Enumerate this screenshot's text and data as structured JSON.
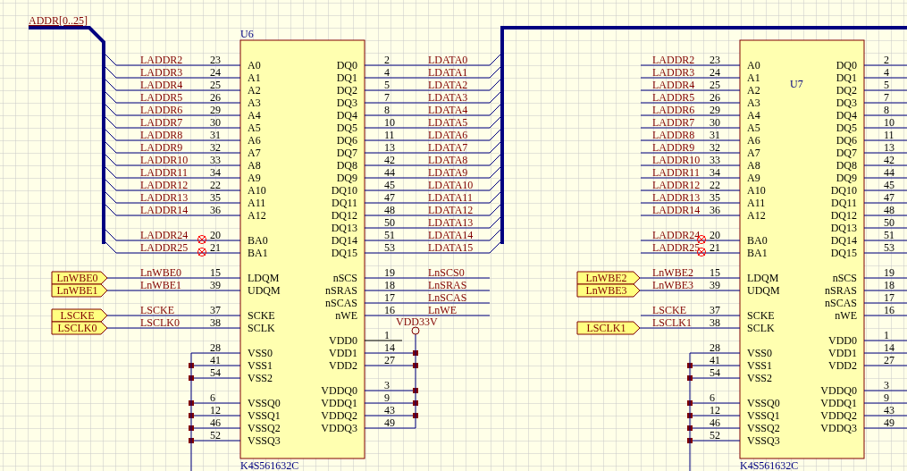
{
  "bus_label": "ADDR[0..25]",
  "parts": [
    {
      "designator": "U6",
      "designator_inside": false,
      "part_number": "K4S561632C",
      "power_net": "VDD33V",
      "left_groups": [
        [
          {
            "number": "23",
            "name": "A0",
            "net": "LADDR2",
            "kind": "bus",
            "no_erc": false
          },
          {
            "number": "24",
            "name": "A1",
            "net": "LADDR3",
            "kind": "bus",
            "no_erc": false
          },
          {
            "number": "25",
            "name": "A2",
            "net": "LADDR4",
            "kind": "bus",
            "no_erc": false
          },
          {
            "number": "26",
            "name": "A3",
            "net": "LADDR5",
            "kind": "bus",
            "no_erc": false
          },
          {
            "number": "29",
            "name": "A4",
            "net": "LADDR6",
            "kind": "bus",
            "no_erc": false
          },
          {
            "number": "30",
            "name": "A5",
            "net": "LADDR7",
            "kind": "bus",
            "no_erc": false
          },
          {
            "number": "31",
            "name": "A6",
            "net": "LADDR8",
            "kind": "bus",
            "no_erc": false
          },
          {
            "number": "32",
            "name": "A7",
            "net": "LADDR9",
            "kind": "bus",
            "no_erc": false
          },
          {
            "number": "33",
            "name": "A8",
            "net": "LADDR10",
            "kind": "bus",
            "no_erc": false
          },
          {
            "number": "34",
            "name": "A9",
            "net": "LADDR11",
            "kind": "bus",
            "no_erc": false
          },
          {
            "number": "22",
            "name": "A10",
            "net": "LADDR12",
            "kind": "bus",
            "no_erc": false
          },
          {
            "number": "35",
            "name": "A11",
            "net": "LADDR13",
            "kind": "bus",
            "no_erc": false
          },
          {
            "number": "36",
            "name": "A12",
            "net": "LADDR14",
            "kind": "bus",
            "no_erc": false
          }
        ],
        [
          {
            "number": "20",
            "name": "BA0",
            "net": "LADDR24",
            "kind": "bus",
            "no_erc": true
          },
          {
            "number": "21",
            "name": "BA1",
            "net": "LADDR25",
            "kind": "bus",
            "no_erc": true
          }
        ],
        [
          {
            "number": "15",
            "name": "LDQM",
            "net": "LnWBE0",
            "port": "LnWBE0",
            "kind": "wire",
            "no_erc": false
          },
          {
            "number": "39",
            "name": "UDQM",
            "net": "LnWBE1",
            "port": "LnWBE1",
            "kind": "wire",
            "no_erc": false
          }
        ],
        [
          {
            "number": "37",
            "name": "SCKE",
            "net": "LSCKE",
            "port": "LSCKE",
            "kind": "wire",
            "no_erc": false
          },
          {
            "number": "38",
            "name": "SCLK",
            "net": "LSCLK0",
            "port": "LSCLK0",
            "kind": "wire",
            "no_erc": false
          }
        ],
        [
          {
            "number": "28",
            "name": "VSS0",
            "kind": "rail",
            "junction": false,
            "no_erc": false
          },
          {
            "number": "41",
            "name": "VSS1",
            "kind": "rail",
            "junction": true,
            "no_erc": false
          },
          {
            "number": "54",
            "name": "VSS2",
            "kind": "rail",
            "junction": true,
            "no_erc": false
          }
        ],
        [
          {
            "number": "6",
            "name": "VSSQ0",
            "kind": "rail",
            "junction": true,
            "no_erc": false
          },
          {
            "number": "12",
            "name": "VSSQ1",
            "kind": "rail",
            "junction": true,
            "no_erc": false
          },
          {
            "number": "46",
            "name": "VSSQ2",
            "kind": "rail",
            "junction": true,
            "no_erc": false
          },
          {
            "number": "52",
            "name": "VSSQ3",
            "kind": "rail",
            "junction": true,
            "no_erc": false
          }
        ]
      ],
      "right_groups": [
        [
          {
            "number": "2",
            "name": "DQ0",
            "net": "LDATA0",
            "kind": "bus"
          },
          {
            "number": "4",
            "name": "DQ1",
            "net": "LDATA1",
            "kind": "bus"
          },
          {
            "number": "5",
            "name": "DQ2",
            "net": "LDATA2",
            "kind": "bus"
          },
          {
            "number": "7",
            "name": "DQ3",
            "net": "LDATA3",
            "kind": "bus"
          },
          {
            "number": "8",
            "name": "DQ4",
            "net": "LDATA4",
            "kind": "bus"
          },
          {
            "number": "10",
            "name": "DQ5",
            "net": "LDATA5",
            "kind": "bus"
          },
          {
            "number": "11",
            "name": "DQ6",
            "net": "LDATA6",
            "kind": "bus"
          },
          {
            "number": "13",
            "name": "DQ7",
            "net": "LDATA7",
            "kind": "bus"
          },
          {
            "number": "42",
            "name": "DQ8",
            "net": "LDATA8",
            "kind": "bus"
          },
          {
            "number": "44",
            "name": "DQ9",
            "net": "LDATA9",
            "kind": "bus"
          },
          {
            "number": "45",
            "name": "DQ10",
            "net": "LDATA10",
            "kind": "bus"
          },
          {
            "number": "47",
            "name": "DQ11",
            "net": "LDATA11",
            "kind": "bus"
          },
          {
            "number": "48",
            "name": "DQ12",
            "net": "LDATA12",
            "kind": "bus"
          },
          {
            "number": "50",
            "name": "DQ13",
            "net": "LDATA13",
            "kind": "bus"
          },
          {
            "number": "51",
            "name": "DQ14",
            "net": "LDATA14",
            "kind": "bus"
          },
          {
            "number": "53",
            "name": "DQ15",
            "net": "LDATA15",
            "kind": "bus"
          }
        ],
        [
          {
            "number": "19",
            "name": "nSCS",
            "net": "LnSCS0",
            "kind": "wire"
          },
          {
            "number": "18",
            "name": "nSRAS",
            "net": "LnSRAS",
            "kind": "wire"
          },
          {
            "number": "17",
            "name": "nSCAS",
            "net": "LnSCAS",
            "kind": "wire"
          },
          {
            "number": "16",
            "name": "nWE",
            "net": "LnWE",
            "kind": "wire"
          }
        ],
        [
          {
            "number": "1",
            "name": "VDD0",
            "kind": "stub"
          },
          {
            "number": "14",
            "name": "VDD1",
            "kind": "rail",
            "junction": true
          },
          {
            "number": "27",
            "name": "VDD2",
            "kind": "rail",
            "junction": true
          }
        ],
        [
          {
            "number": "3",
            "name": "VDDQ0",
            "kind": "rail",
            "junction": true
          },
          {
            "number": "9",
            "name": "VDDQ1",
            "kind": "rail",
            "junction": true
          },
          {
            "number": "43",
            "name": "VDDQ2",
            "kind": "rail",
            "junction": true
          },
          {
            "number": "49",
            "name": "VDDQ3",
            "kind": "rail",
            "junction": false
          }
        ]
      ]
    },
    {
      "designator": "U7",
      "designator_inside": true,
      "part_number": "K4S561632C",
      "left_groups": [
        [
          {
            "number": "23",
            "name": "A0",
            "net": "LADDR2",
            "kind": "wire",
            "no_erc": false
          },
          {
            "number": "24",
            "name": "A1",
            "net": "LADDR3",
            "kind": "wire",
            "no_erc": false
          },
          {
            "number": "25",
            "name": "A2",
            "net": "LADDR4",
            "kind": "wire",
            "no_erc": false
          },
          {
            "number": "26",
            "name": "A3",
            "net": "LADDR5",
            "kind": "wire",
            "no_erc": false
          },
          {
            "number": "29",
            "name": "A4",
            "net": "LADDR6",
            "kind": "wire",
            "no_erc": false
          },
          {
            "number": "30",
            "name": "A5",
            "net": "LADDR7",
            "kind": "wire",
            "no_erc": false
          },
          {
            "number": "31",
            "name": "A6",
            "net": "LADDR8",
            "kind": "wire",
            "no_erc": false
          },
          {
            "number": "32",
            "name": "A7",
            "net": "LADDR9",
            "kind": "wire",
            "no_erc": false
          },
          {
            "number": "33",
            "name": "A8",
            "net": "LADDR10",
            "kind": "wire",
            "no_erc": false
          },
          {
            "number": "34",
            "name": "A9",
            "net": "LADDR11",
            "kind": "wire",
            "no_erc": false
          },
          {
            "number": "22",
            "name": "A10",
            "net": "LADDR12",
            "kind": "wire",
            "no_erc": false
          },
          {
            "number": "35",
            "name": "A11",
            "net": "LADDR13",
            "kind": "wire",
            "no_erc": false
          },
          {
            "number": "36",
            "name": "A12",
            "net": "LADDR14",
            "kind": "wire",
            "no_erc": false
          }
        ],
        [
          {
            "number": "20",
            "name": "BA0",
            "net": "LADDR24",
            "kind": "wire",
            "no_erc": true
          },
          {
            "number": "21",
            "name": "BA1",
            "net": "LADDR25",
            "kind": "wire",
            "no_erc": true
          }
        ],
        [
          {
            "number": "15",
            "name": "LDQM",
            "net": "LnWBE2",
            "port": "LnWBE2",
            "kind": "wire",
            "no_erc": false
          },
          {
            "number": "39",
            "name": "UDQM",
            "net": "LnWBE3",
            "port": "LnWBE3",
            "kind": "wire",
            "no_erc": false
          }
        ],
        [
          {
            "number": "37",
            "name": "SCKE",
            "net": "LSCKE",
            "kind": "wire",
            "no_erc": false
          },
          {
            "number": "38",
            "name": "SCLK",
            "net": "LSCLK1",
            "port": "LSCLK1",
            "kind": "wire",
            "no_erc": false
          }
        ],
        [
          {
            "number": "28",
            "name": "VSS0",
            "kind": "rail",
            "junction": false,
            "no_erc": false
          },
          {
            "number": "41",
            "name": "VSS1",
            "kind": "rail",
            "junction": true,
            "no_erc": false
          },
          {
            "number": "54",
            "name": "VSS2",
            "kind": "rail",
            "junction": true,
            "no_erc": false
          }
        ],
        [
          {
            "number": "6",
            "name": "VSSQ0",
            "kind": "rail",
            "junction": true,
            "no_erc": false
          },
          {
            "number": "12",
            "name": "VSSQ1",
            "kind": "rail",
            "junction": true,
            "no_erc": false
          },
          {
            "number": "46",
            "name": "VSSQ2",
            "kind": "rail",
            "junction": true,
            "no_erc": false
          },
          {
            "number": "52",
            "name": "VSSQ3",
            "kind": "rail",
            "junction": true,
            "no_erc": false
          }
        ]
      ],
      "right_groups": [
        [
          {
            "number": "2",
            "name": "DQ0",
            "kind": "edge"
          },
          {
            "number": "4",
            "name": "DQ1",
            "kind": "edge"
          },
          {
            "number": "5",
            "name": "DQ2",
            "kind": "edge"
          },
          {
            "number": "7",
            "name": "DQ3",
            "kind": "edge"
          },
          {
            "number": "8",
            "name": "DQ4",
            "kind": "edge"
          },
          {
            "number": "10",
            "name": "DQ5",
            "kind": "edge"
          },
          {
            "number": "11",
            "name": "DQ6",
            "kind": "edge"
          },
          {
            "number": "13",
            "name": "DQ7",
            "kind": "edge"
          },
          {
            "number": "42",
            "name": "DQ8",
            "kind": "edge"
          },
          {
            "number": "44",
            "name": "DQ9",
            "kind": "edge"
          },
          {
            "number": "45",
            "name": "DQ10",
            "kind": "edge"
          },
          {
            "number": "47",
            "name": "DQ11",
            "kind": "edge"
          },
          {
            "number": "48",
            "name": "DQ12",
            "kind": "edge"
          },
          {
            "number": "50",
            "name": "DQ13",
            "kind": "edge"
          },
          {
            "number": "51",
            "name": "DQ14",
            "kind": "edge"
          },
          {
            "number": "53",
            "name": "DQ15",
            "kind": "edge"
          }
        ],
        [
          {
            "number": "19",
            "name": "nSCS",
            "kind": "edge"
          },
          {
            "number": "18",
            "name": "nSRAS",
            "kind": "edge"
          },
          {
            "number": "17",
            "name": "nSCAS",
            "kind": "edge"
          },
          {
            "number": "16",
            "name": "nWE",
            "kind": "edge"
          }
        ],
        [
          {
            "number": "1",
            "name": "VDD0",
            "kind": "edge"
          },
          {
            "number": "14",
            "name": "VDD1",
            "kind": "edge"
          },
          {
            "number": "27",
            "name": "VDD2",
            "kind": "edge"
          }
        ],
        [
          {
            "number": "3",
            "name": "VDDQ0",
            "kind": "edge"
          },
          {
            "number": "9",
            "name": "VDDQ1",
            "kind": "edge"
          },
          {
            "number": "43",
            "name": "VDDQ2",
            "kind": "edge"
          },
          {
            "number": "49",
            "name": "VDDQ3",
            "kind": "edge"
          }
        ]
      ]
    }
  ]
}
